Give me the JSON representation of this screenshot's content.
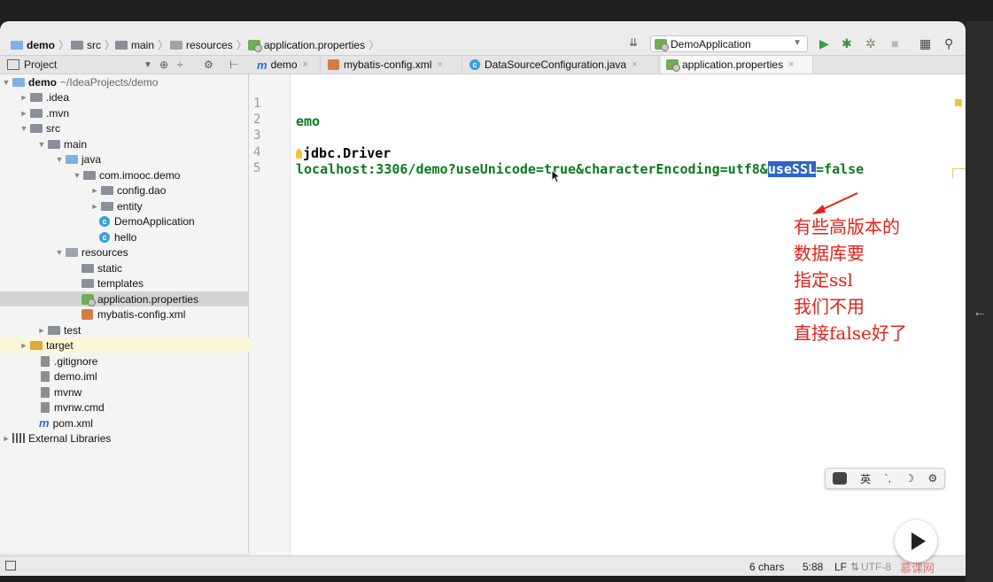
{
  "breadcrumb": [
    {
      "label": "demo",
      "icon": "module-folder-icon"
    },
    {
      "label": "src",
      "icon": "folder-icon"
    },
    {
      "label": "main",
      "icon": "folder-icon"
    },
    {
      "label": "resources",
      "icon": "resources-folder-icon"
    },
    {
      "label": "application.properties",
      "icon": "properties-file-icon"
    }
  ],
  "run_config": {
    "label": "DemoApplication"
  },
  "project_panel": {
    "title": "Project"
  },
  "tabs": [
    {
      "label": "demo",
      "icon": "maven-icon",
      "active": false
    },
    {
      "label": "mybatis-config.xml",
      "icon": "xml-file-icon",
      "active": false
    },
    {
      "label": "DataSourceConfiguration.java",
      "icon": "java-class-icon",
      "active": false
    },
    {
      "label": "application.properties",
      "icon": "properties-file-icon",
      "active": true
    }
  ],
  "tree": [
    {
      "label": "demo",
      "extra": "~/IdeaProjects/demo",
      "depth": 0,
      "arrow": "▼",
      "bold": true
    },
    {
      "label": ".idea",
      "depth": 1,
      "arrow": "►"
    },
    {
      "label": ".mvn",
      "depth": 1,
      "arrow": "►"
    },
    {
      "label": "src",
      "depth": 1,
      "arrow": "▼"
    },
    {
      "label": "main",
      "depth": 2,
      "arrow": "▼"
    },
    {
      "label": "java",
      "depth": 3,
      "arrow": "▼"
    },
    {
      "label": "com.imooc.demo",
      "depth": 4,
      "arrow": "▼"
    },
    {
      "label": "config.dao",
      "depth": 5,
      "arrow": "►"
    },
    {
      "label": "entity",
      "depth": 5,
      "arrow": "►"
    },
    {
      "label": "DemoApplication",
      "depth": 5,
      "arrow": ""
    },
    {
      "label": "hello",
      "depth": 5,
      "arrow": ""
    },
    {
      "label": "resources",
      "depth": 3,
      "arrow": "▼"
    },
    {
      "label": "static",
      "depth": 4,
      "arrow": ""
    },
    {
      "label": "templates",
      "depth": 4,
      "arrow": ""
    },
    {
      "label": "application.properties",
      "depth": 4,
      "arrow": "",
      "selected": true
    },
    {
      "label": "mybatis-config.xml",
      "depth": 4,
      "arrow": ""
    },
    {
      "label": "test",
      "depth": 2,
      "arrow": "►"
    },
    {
      "label": "target",
      "depth": 1,
      "arrow": "►",
      "highlight": true
    },
    {
      "label": ".gitignore",
      "depth": 1,
      "arrow": ""
    },
    {
      "label": "demo.iml",
      "depth": 1,
      "arrow": ""
    },
    {
      "label": "mvnw",
      "depth": 1,
      "arrow": ""
    },
    {
      "label": "mvnw.cmd",
      "depth": 1,
      "arrow": ""
    },
    {
      "label": "pom.xml",
      "depth": 1,
      "arrow": ""
    },
    {
      "label": "External Libraries",
      "depth": 0,
      "arrow": "►"
    }
  ],
  "editor": {
    "line_numbers": [
      "1",
      "2",
      "3",
      "4",
      "5"
    ],
    "line2": "emo",
    "line4": "jdbc.Driver",
    "line5_before": "localhost:3306/demo?useUnicode=true&characterEncoding=utf8&",
    "line5_selected": "useSSL",
    "line5_after": "=false"
  },
  "annotation": {
    "color": "#e3211b",
    "lines": [
      "有些高版本的",
      "数据库要",
      "指定ssl",
      "我们不用",
      "直接false好了"
    ]
  },
  "ime": {
    "lang": "英",
    "punct": "`,",
    "moon": "☽",
    "gear": "⚙"
  },
  "status": {
    "chars": "6 chars",
    "position": "5:88",
    "line_sep": "LF",
    "encoding": "UTF-8"
  },
  "colors": {
    "selection": "#2f65c8",
    "code_green": "#0a7a1e",
    "accent_blue": "#2f6bd5"
  }
}
